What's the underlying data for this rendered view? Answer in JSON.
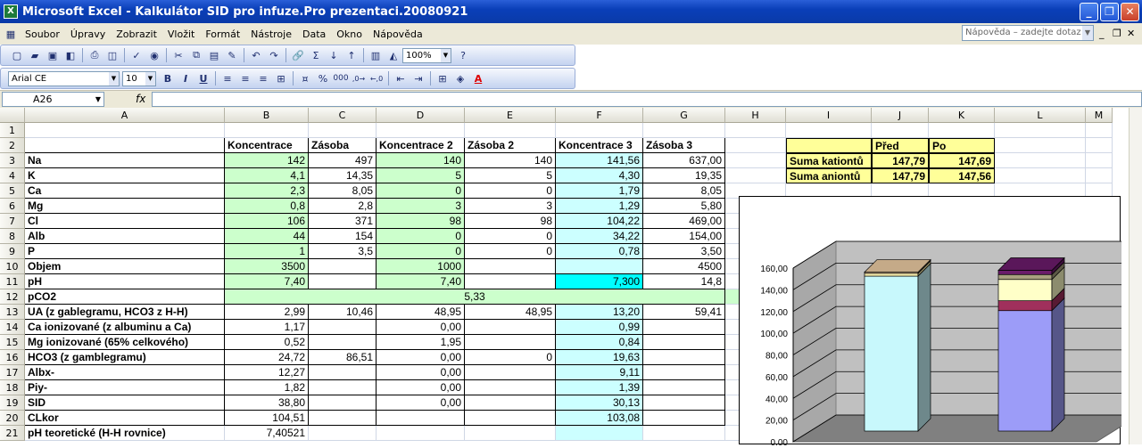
{
  "window": {
    "title": "Microsoft Excel - Kalkulátor SID pro infuze.Pro prezentaci.20080921",
    "app_icon": "excel-icon"
  },
  "menu": [
    "Soubor",
    "Úpravy",
    "Zobrazit",
    "Vložit",
    "Formát",
    "Nástroje",
    "Data",
    "Okno",
    "Nápověda"
  ],
  "help_placeholder": "Nápověda – zadejte dotaz",
  "toolbar": {
    "zoom": "100%",
    "font": "Arial CE",
    "size": "10"
  },
  "formula_bar": {
    "name_box": "A26",
    "fx": "fx"
  },
  "columns": [
    "A",
    "B",
    "C",
    "D",
    "E",
    "F",
    "G",
    "H",
    "I",
    "J",
    "K",
    "L",
    "M"
  ],
  "rows": [
    {
      "n": "1",
      "cells": [
        "",
        "",
        "",
        "",
        "",
        "",
        "",
        ""
      ]
    },
    {
      "n": "2",
      "cells": [
        "",
        "Koncentrace",
        "Zásoba",
        "Koncentrace 2",
        "Zásoba 2",
        "Koncentrace 3",
        "Zásoba 3",
        ""
      ]
    },
    {
      "n": "3",
      "cells": [
        "Na",
        "142",
        "497",
        "140",
        "140",
        "141,56",
        "637,00",
        ""
      ]
    },
    {
      "n": "4",
      "cells": [
        "K",
        "4,1",
        "14,35",
        "5",
        "5",
        "4,30",
        "19,35",
        ""
      ]
    },
    {
      "n": "5",
      "cells": [
        "Ca",
        "2,3",
        "8,05",
        "0",
        "0",
        "1,79",
        "8,05",
        ""
      ]
    },
    {
      "n": "6",
      "cells": [
        "Mg",
        "0,8",
        "2,8",
        "3",
        "3",
        "1,29",
        "5,80",
        ""
      ]
    },
    {
      "n": "7",
      "cells": [
        "Cl",
        "106",
        "371",
        "98",
        "98",
        "104,22",
        "469,00",
        ""
      ]
    },
    {
      "n": "8",
      "cells": [
        "Alb",
        "44",
        "154",
        "0",
        "0",
        "34,22",
        "154,00",
        ""
      ]
    },
    {
      "n": "9",
      "cells": [
        "P",
        "1",
        "3,5",
        "0",
        "0",
        "0,78",
        "3,50",
        ""
      ]
    },
    {
      "n": "10",
      "cells": [
        "Objem",
        "3500",
        "",
        "1000",
        "",
        "",
        "4500",
        ""
      ]
    },
    {
      "n": "11",
      "cells": [
        "pH",
        "7,40",
        "",
        "7,40",
        "",
        "7,300",
        "14,8",
        ""
      ]
    },
    {
      "n": "12",
      "cells": [
        "pCO2",
        "5,33",
        "",
        "",
        "",
        "",
        "",
        ""
      ]
    },
    {
      "n": "13",
      "cells": [
        "UA (z gablegramu, HCO3 z H-H)",
        "2,99",
        "10,46",
        "48,95",
        "48,95",
        "13,20",
        "59,41",
        ""
      ]
    },
    {
      "n": "14",
      "cells": [
        "Ca ionizované (z albuminu a Ca)",
        "1,17",
        "",
        "0,00",
        "",
        "0,99",
        "",
        ""
      ]
    },
    {
      "n": "15",
      "cells": [
        "Mg ionizované (65% celkového)",
        "0,52",
        "",
        "1,95",
        "",
        "0,84",
        "",
        ""
      ]
    },
    {
      "n": "16",
      "cells": [
        "HCO3 (z gamblegramu)",
        "24,72",
        "86,51",
        "0,00",
        "0",
        "19,63",
        "",
        ""
      ]
    },
    {
      "n": "17",
      "cells": [
        "Albx-",
        "12,27",
        "",
        "0,00",
        "",
        "9,11",
        "",
        ""
      ]
    },
    {
      "n": "18",
      "cells": [
        "Piy-",
        "1,82",
        "",
        "0,00",
        "",
        "1,39",
        "",
        ""
      ]
    },
    {
      "n": "19",
      "cells": [
        "SID",
        "38,80",
        "",
        "0,00",
        "",
        "30,13",
        "",
        ""
      ]
    },
    {
      "n": "20",
      "cells": [
        "CLkor",
        "104,51",
        "",
        "",
        "",
        "103,08",
        "",
        ""
      ]
    },
    {
      "n": "21",
      "cells": [
        "pH teoretické (H-H rovnice)",
        "7,40521",
        "",
        "",
        "",
        "",
        "",
        ""
      ]
    }
  ],
  "summary": {
    "header": [
      "",
      "Před",
      "Po"
    ],
    "rows": [
      [
        "Suma kationtů",
        "147,79",
        "147,69"
      ],
      [
        "Suma aniontů",
        "147,79",
        "147,56"
      ]
    ]
  },
  "chart_data": {
    "type": "bar",
    "subtype": "stacked-3d",
    "yticks": [
      "0,00",
      "20,00",
      "40,00",
      "60,00",
      "80,00",
      "100,00",
      "120,00",
      "140,00",
      "160,00"
    ],
    "ylim": [
      0,
      160
    ],
    "series": [
      {
        "color": "#c8f8fc",
        "values": [
          142.76,
          0
        ]
      },
      {
        "color": "#fff4b0",
        "values": [
          2.56,
          0
        ]
      },
      {
        "color": "#e8c8a0",
        "values": [
          1.1,
          0
        ]
      },
      {
        "color": "#9c9cf8",
        "values": [
          0,
          111.0
        ]
      },
      {
        "color": "#a0305c",
        "values": [
          0,
          9.1
        ]
      },
      {
        "color": "#ffffc8",
        "values": [
          0,
          19.6
        ]
      },
      {
        "color": "#a8a080",
        "values": [
          0,
          4.5
        ]
      },
      {
        "color": "#6a1b6a",
        "values": [
          0,
          3.9
        ]
      }
    ]
  }
}
